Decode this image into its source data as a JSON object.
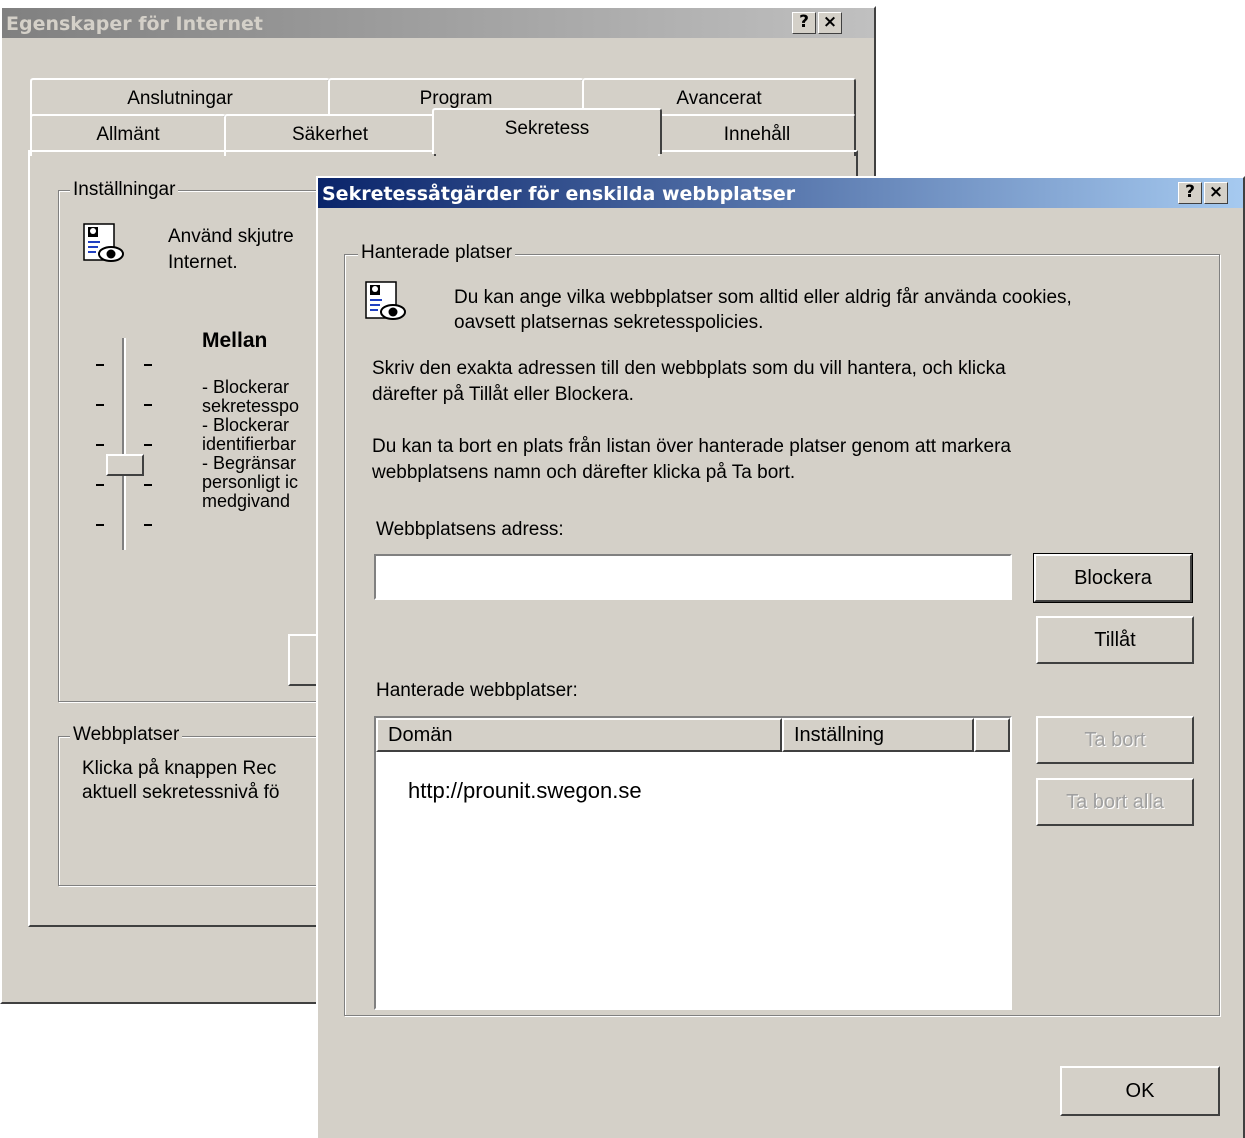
{
  "back_window": {
    "title": "Egenskaper för Internet",
    "help_button": "?",
    "close_button": "×",
    "tabs_row1": [
      "Anslutningar",
      "Program",
      "Avancerat"
    ],
    "tabs_row2": [
      "Allmänt",
      "Säkerhet",
      "Sekretess",
      "Innehåll"
    ],
    "active_tab": "Sekretess",
    "settings_group": {
      "legend": "Inställningar",
      "desc_line1": "Använd skjutre",
      "desc_line2": "Internet.",
      "level_name": "Mellan",
      "level_lines": [
        "- Blockerar",
        "sekretesspo",
        "- Blockerar",
        "identifierbar",
        "- Begränsar",
        "personligt ic",
        "medgivand"
      ]
    },
    "sites_group": {
      "legend": "Webbplatser",
      "line1": "Klicka på knappen Rec",
      "line2": "aktuell sekretessnivå fö"
    }
  },
  "front_dialog": {
    "title": "Sekretessåtgärder för enskilda webbplatser",
    "help_button": "?",
    "close_button": "×",
    "group_legend": "Hanterade platser",
    "info_line1": "Du kan ange vilka webbplatser som alltid eller aldrig får använda cookies,",
    "info_line2": "oavsett platsernas sekretesspolicies.",
    "instr1_line1": "Skriv den exakta adressen till den webbplats som du vill hantera, och klicka",
    "instr1_line2": "därefter på Tillåt eller Blockera.",
    "instr2_line1": "Du kan ta bort en plats från listan över hanterade platser genom att markera",
    "instr2_line2": "webbplatsens namn och därefter klicka på Ta bort.",
    "address_label": "Webbplatsens adress:",
    "address_value": "",
    "block_button": "Blockera",
    "allow_button": "Tillåt",
    "managed_label": "Hanterade webbplatser:",
    "columns": [
      "Domän",
      "Inställning"
    ],
    "rows": [
      {
        "domain": "http://prounit.swegon.se",
        "setting": ""
      }
    ],
    "remove_button": "Ta bort",
    "remove_all_button": "Ta bort alla",
    "ok_button": "OK"
  },
  "colors": {
    "face": "#d4d0c8",
    "front_title_start": "#0a246a",
    "front_title_end": "#a6caf0",
    "back_title_start": "#808080",
    "back_title_end": "#c0c0c0"
  }
}
